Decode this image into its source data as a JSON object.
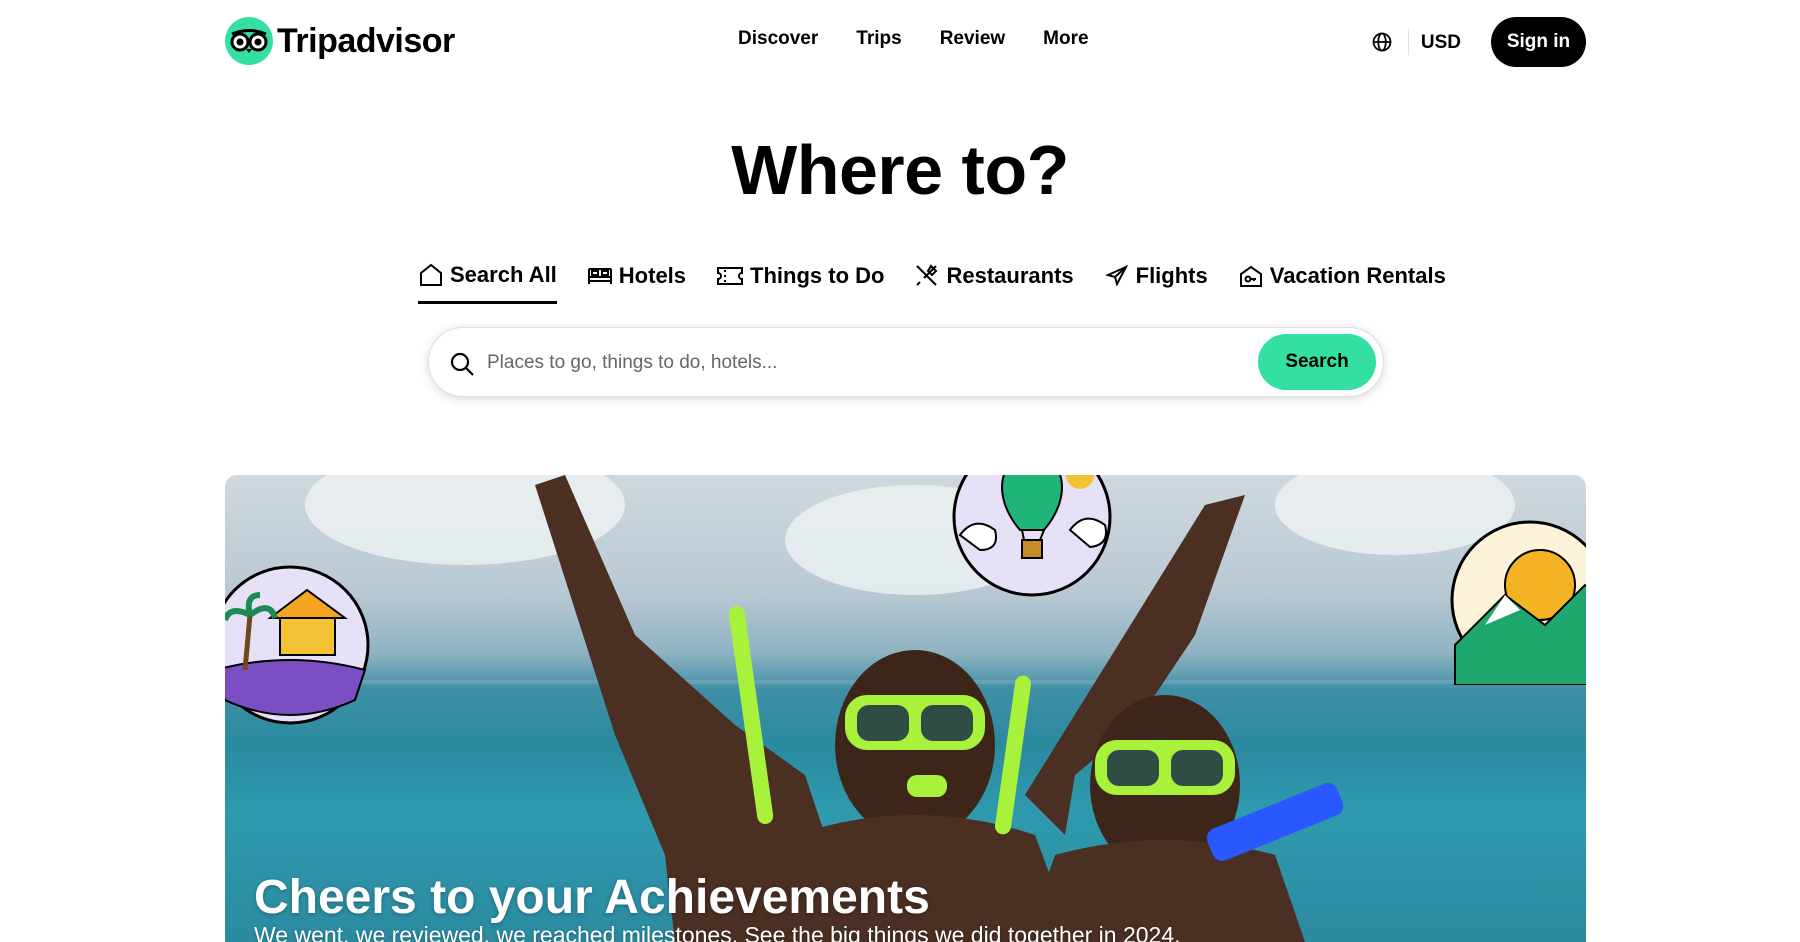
{
  "header": {
    "logo_text": "Tripadvisor",
    "nav": [
      "Discover",
      "Trips",
      "Review",
      "More"
    ],
    "currency": "USD",
    "signin_label": "Sign in"
  },
  "hero": {
    "title": "Where to?",
    "tabs": [
      {
        "label": "Search All",
        "icon": "home-icon",
        "active": true
      },
      {
        "label": "Hotels",
        "icon": "bed-icon",
        "active": false
      },
      {
        "label": "Things to Do",
        "icon": "ticket-icon",
        "active": false
      },
      {
        "label": "Restaurants",
        "icon": "utensils-icon",
        "active": false
      },
      {
        "label": "Flights",
        "icon": "plane-icon",
        "active": false
      },
      {
        "label": "Vacation Rentals",
        "icon": "house-key-icon",
        "active": false
      }
    ],
    "search": {
      "placeholder": "Places to go, things to do, hotels...",
      "button_label": "Search"
    }
  },
  "banner": {
    "title": "Cheers to your Achievements",
    "subtitle": "We went, we reviewed, we reached milestones. See the big things we did together in 2024."
  },
  "colors": {
    "brand_green": "#34e0a1",
    "text": "#000000"
  }
}
